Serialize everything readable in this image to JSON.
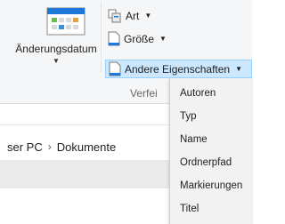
{
  "ribbon": {
    "date_button_label": "Änderungsdatum",
    "art_label": "Art",
    "groesse_label": "Größe",
    "andere_label": "Andere Eigenschaften",
    "group_label_truncated": "Verfei"
  },
  "breadcrumb": {
    "part1": "ser PC",
    "separator": "›",
    "part2": "Dokumente"
  },
  "menu": {
    "items": [
      "Autoren",
      "Typ",
      "Name",
      "Ordnerpfad",
      "Markierungen",
      "Titel"
    ]
  },
  "icons": {
    "calendar": "calendar-icon",
    "art": "type-icon",
    "groesse": "document-icon",
    "andere": "document-icon",
    "dropdown": "caret-down-icon"
  },
  "colors": {
    "ribbon_bg": "#f5f6f7",
    "highlight_bg": "#cce8ff",
    "highlight_border": "#99d1ff",
    "menu_bg": "#f2f2f2",
    "accent_blue": "#1e78d7"
  }
}
